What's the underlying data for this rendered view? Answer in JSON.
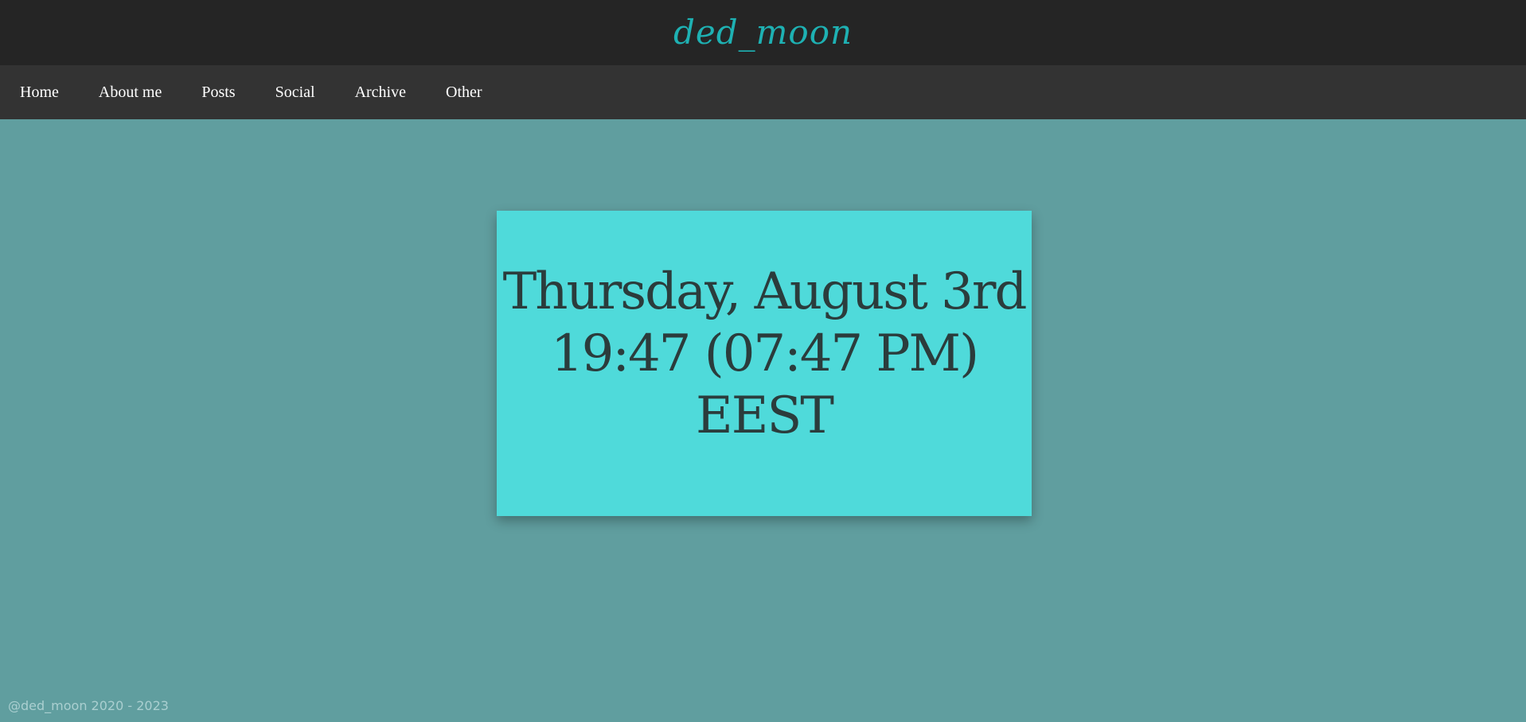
{
  "header": {
    "title": "ded_moon"
  },
  "nav": {
    "items": [
      {
        "label": "Home"
      },
      {
        "label": "About me"
      },
      {
        "label": "Posts"
      },
      {
        "label": "Social"
      },
      {
        "label": "Archive"
      },
      {
        "label": "Other"
      }
    ]
  },
  "clock": {
    "date": "Thursday, August 3rd",
    "time": "19:47 (07:47 PM)",
    "timezone": "EEST"
  },
  "footer": {
    "copyright": "@ded_moon 2020 - 2023"
  },
  "colors": {
    "page_background": "#609e9f",
    "header_background": "#252525",
    "nav_background": "#333333",
    "title_accent": "#1eb1b3",
    "card_background": "#4fdada",
    "card_text": "#2b3c3c"
  }
}
